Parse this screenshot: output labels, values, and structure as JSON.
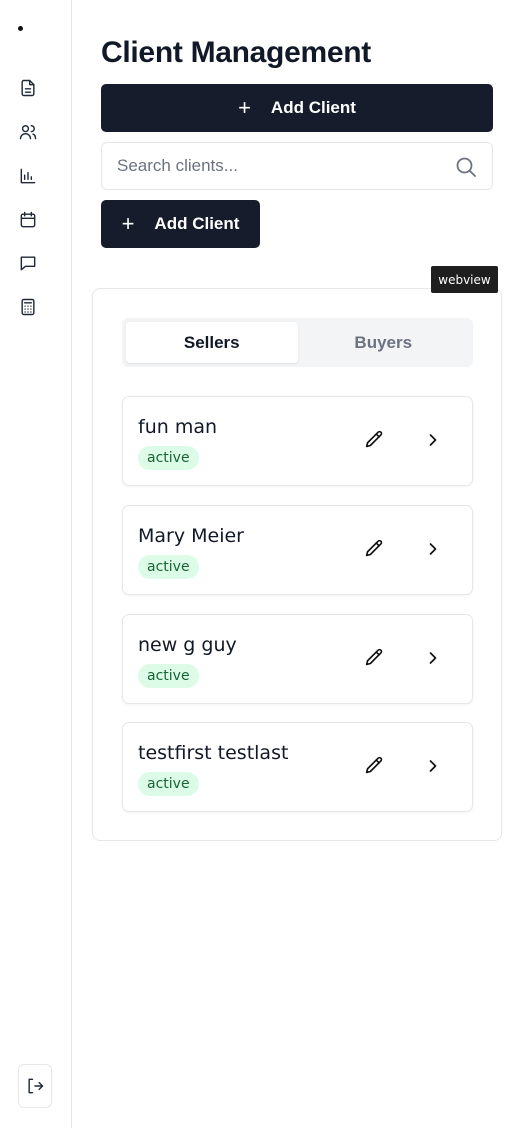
{
  "page": {
    "title": "Client Management"
  },
  "actions": {
    "add_client_primary": "Add Client",
    "add_client_secondary": "Add Client",
    "plus_symbol": "+"
  },
  "search": {
    "placeholder": "Search clients...",
    "value": ""
  },
  "tooltip": {
    "text": "webview"
  },
  "tabs": [
    {
      "label": "Sellers",
      "active": true
    },
    {
      "label": "Buyers",
      "active": false
    }
  ],
  "clients": [
    {
      "name": "fun man",
      "status": "active"
    },
    {
      "name": "Mary Meier",
      "status": "active"
    },
    {
      "name": "new g guy",
      "status": "active"
    },
    {
      "name": "testfirst testlast",
      "status": "active"
    }
  ],
  "sidebar": {
    "items": [
      {
        "icon": "document-icon"
      },
      {
        "icon": "users-icon"
      },
      {
        "icon": "bar-chart-icon"
      },
      {
        "icon": "calendar-icon"
      },
      {
        "icon": "message-icon"
      },
      {
        "icon": "calculator-icon"
      }
    ],
    "logout_icon": "logout-icon"
  },
  "colors": {
    "primary": "#161c2c",
    "badge_bg": "#dcfce7",
    "badge_text": "#166534",
    "border": "#e5e7eb"
  }
}
